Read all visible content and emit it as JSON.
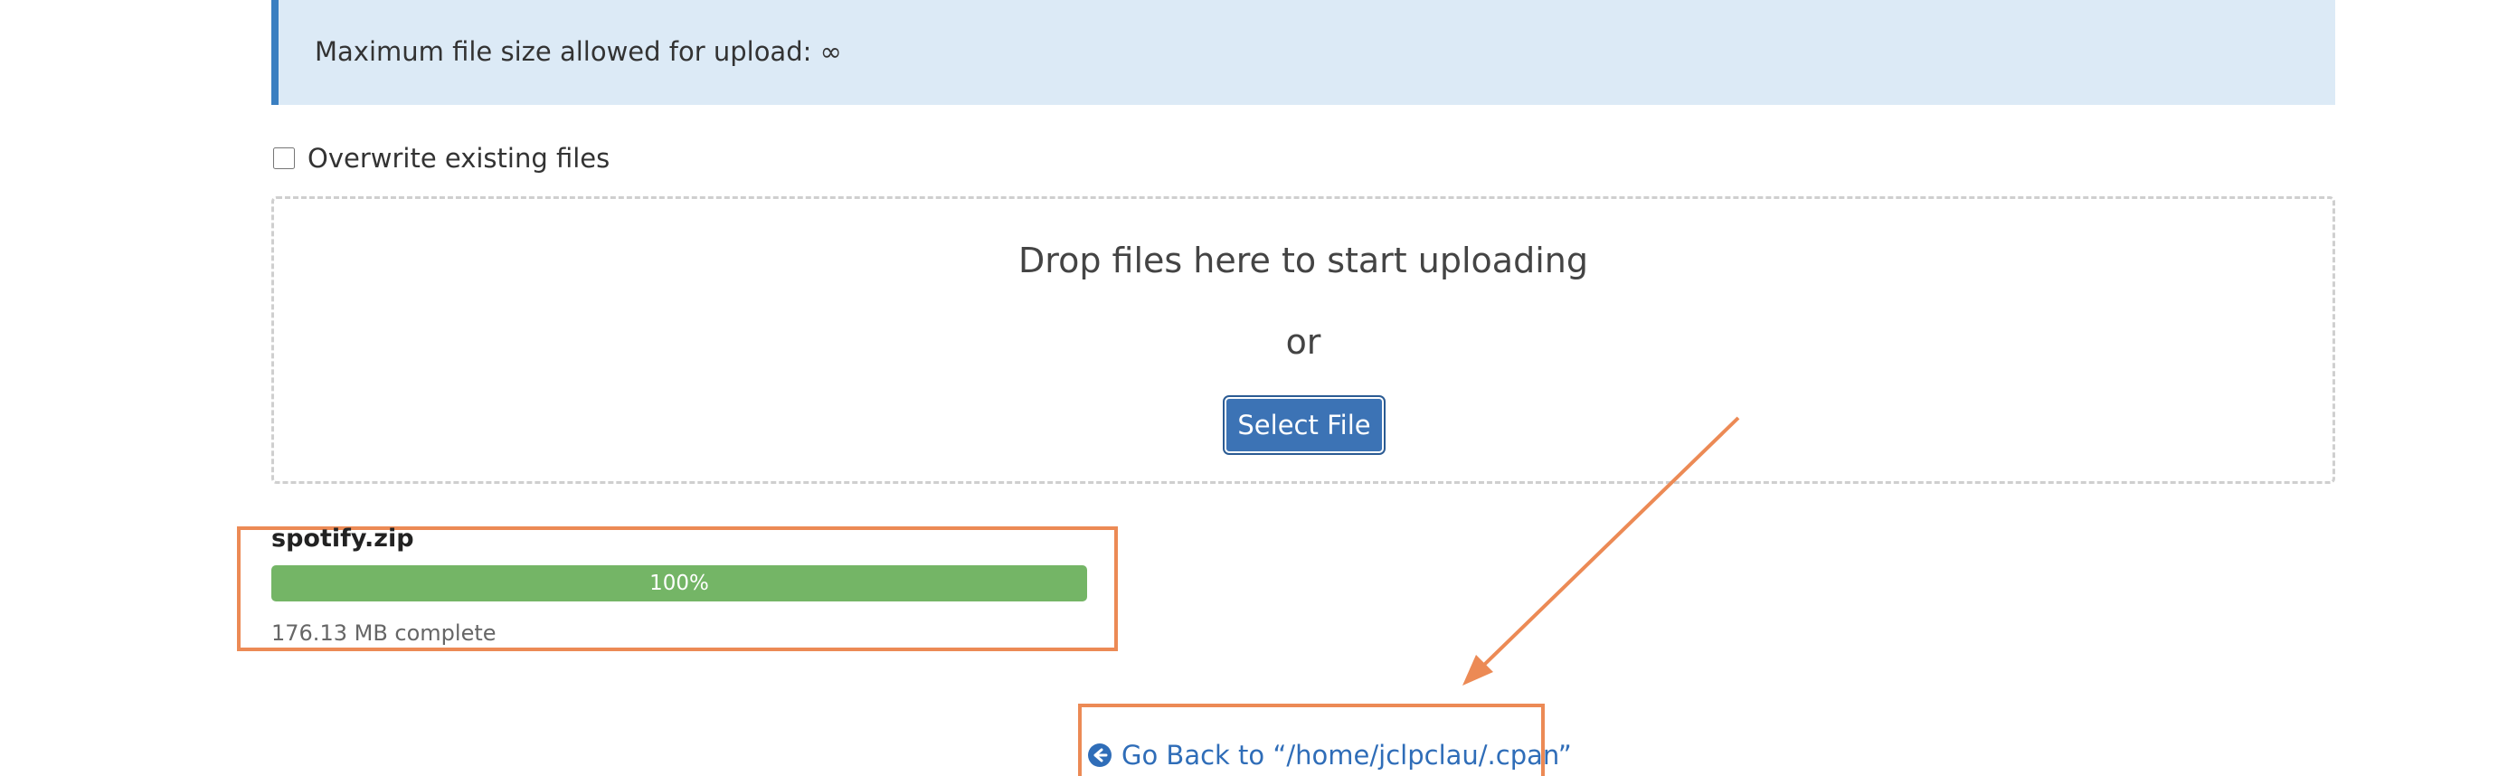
{
  "upload_info": {
    "max_size_text": "Maximum file size allowed for upload: ∞"
  },
  "overwrite": {
    "label": "Overwrite existing files",
    "checked": false
  },
  "dropzone": {
    "drop_text": "Drop files here to start uploading",
    "or_text": "or",
    "select_button_label": "Select File"
  },
  "upload": {
    "file_name": "spotify.zip",
    "progress_percent": 100,
    "progress_label": "100%",
    "status_text": "176.13 MB complete"
  },
  "navigation": {
    "go_back_label": "Go Back to “/home/jclpclau/.cpan”",
    "icon": "circle-arrow-left-icon"
  },
  "colors": {
    "accent": "#3c73b5",
    "progress": "#74b566",
    "annotation": "#ec8a55",
    "info_bg": "#dceaf6",
    "link": "#2f6db8"
  }
}
